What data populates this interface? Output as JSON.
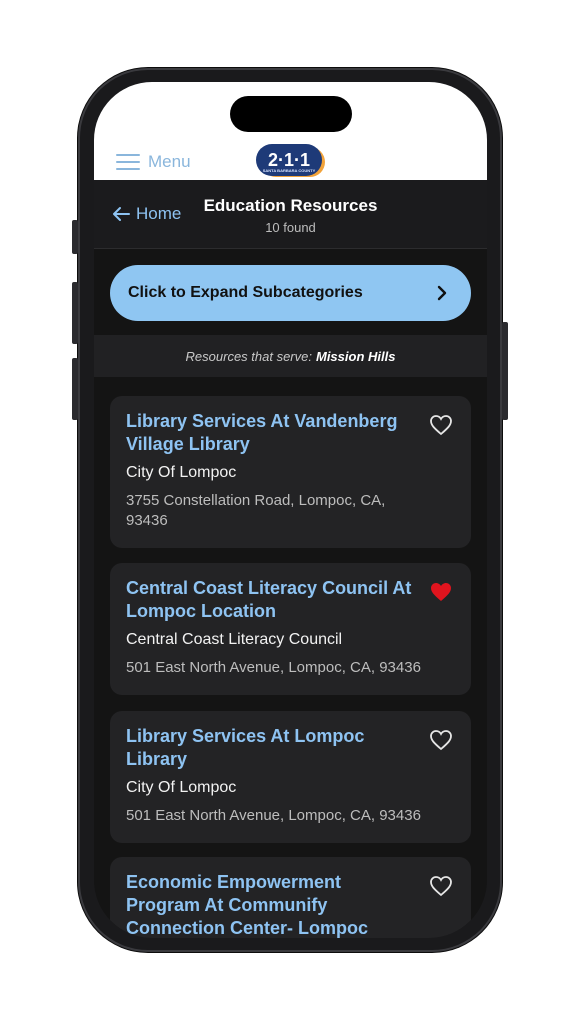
{
  "header": {
    "menu_label": "Menu",
    "logo_text": "2·1·1",
    "logo_subtext": "SANTA BARBARA COUNTY"
  },
  "nav": {
    "back_label": "Home",
    "title": "Education Resources",
    "count": "10 found"
  },
  "expand_button": {
    "label": "Click to Expand Subcategories"
  },
  "serve_banner": {
    "prefix": "Resources that serve:",
    "location": "Mission Hills"
  },
  "resources": [
    {
      "name": "Library Services At Vandenberg Village Library",
      "org": "City Of Lompoc",
      "address": "3755 Constellation Road, Lompoc, CA, 93436",
      "favorited": false
    },
    {
      "name": "Central Coast Literacy Council At Lompoc Location",
      "org": "Central Coast Literacy Council",
      "address": "501 East North Avenue, Lompoc, CA, 93436",
      "favorited": true
    },
    {
      "name": "Library Services At Lompoc Library",
      "org": "City Of Lompoc",
      "address": "501 East North Avenue, Lompoc, CA, 93436",
      "favorited": false
    },
    {
      "name": "Economic Empowerment Program At Communify Connection Center- Lompoc",
      "org": "",
      "address": "",
      "favorited": false
    }
  ],
  "colors": {
    "accent": "#8ec3f2",
    "favorite": "#e0141e",
    "background": "#141414",
    "card": "#232325"
  }
}
